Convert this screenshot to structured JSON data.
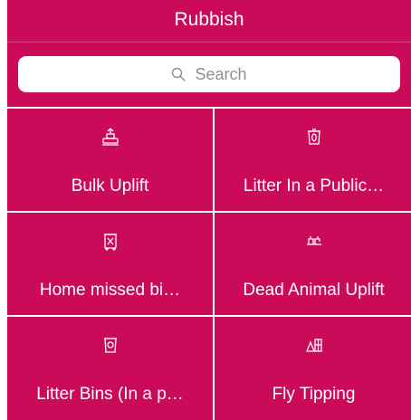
{
  "header": {
    "title": "Rubbish"
  },
  "search": {
    "placeholder": "Search",
    "icon": "search-icon"
  },
  "theme": {
    "accent": "#cc0a5a",
    "text_on_accent": "#ffffff",
    "search_placeholder": "#8e8e93"
  },
  "tiles": [
    {
      "label": "Bulk Uplift",
      "icon": "bulk-uplift-icon"
    },
    {
      "label": "Litter In a Public…",
      "icon": "apple-core-bin-icon"
    },
    {
      "label": "Home missed bi…",
      "icon": "wheelie-bin-icon"
    },
    {
      "label": "Dead Animal Uplift",
      "icon": "dead-animal-icon"
    },
    {
      "label": "Litter Bins (In a p…",
      "icon": "litter-bin-icon"
    },
    {
      "label": "Fly Tipping",
      "icon": "fly-tipping-icon"
    }
  ]
}
